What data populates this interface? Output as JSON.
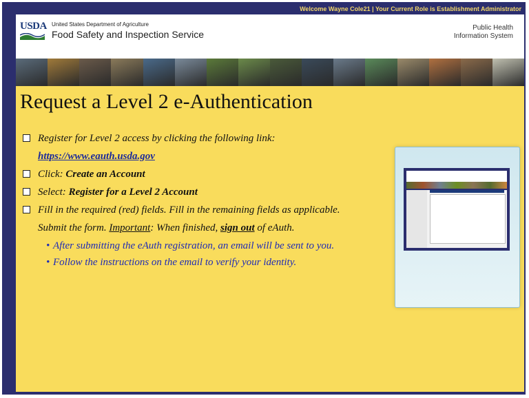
{
  "topbar": {
    "text": "Welcome Wayne Cole21  |  Your Current Role is Establishment Administrator"
  },
  "header": {
    "logo_text": "USDA",
    "dept": "United States Department of Agriculture",
    "agency": "Food Safety and Inspection Service",
    "system_line1": "Public Health",
    "system_line2": "Information System"
  },
  "photos": [
    "#5a6b7a",
    "#a07a3a",
    "#6a5a4a",
    "#8a7a5a",
    "#4a6a8a",
    "#7a8a9a",
    "#5b7a3a",
    "#6b8a4a",
    "#4a5a3a",
    "#3a4a5a",
    "#6a7a8a",
    "#5a8a5a",
    "#9a8a6a",
    "#b07040",
    "#8a6a4a",
    "#c0c0b0"
  ],
  "slide": {
    "title": "Request a Level 2 e-Authentication",
    "b1": "Register for Level 2 access by clicking the following link:",
    "link": "https://www.eauth.usda.gov",
    "b2_prefix": "Click: ",
    "b2_bold": "Create an Account",
    "b3_prefix": "Select: ",
    "b3_bold": "Register for a Level 2 Account",
    "b4_line1": "Fill in the required (red) fields. Fill in the remaining fields as applicable.",
    "b4_line2_a": "Submit the form. ",
    "b4_important": "Important",
    "b4_line2_b": ": When finished, ",
    "b4_signout": "sign out",
    "b4_line2_c": " of eAuth.",
    "sub1": "After submitting the eAuth registration, an email will be sent to you.",
    "sub2": "Follow the instructions on the email to verify your identity."
  },
  "colors": {
    "navy": "#2b2e6e",
    "gold": "#f1d56a",
    "slide_bg": "#f9dc5c",
    "link": "#1b2a9a",
    "sub": "#1f2bb5"
  }
}
